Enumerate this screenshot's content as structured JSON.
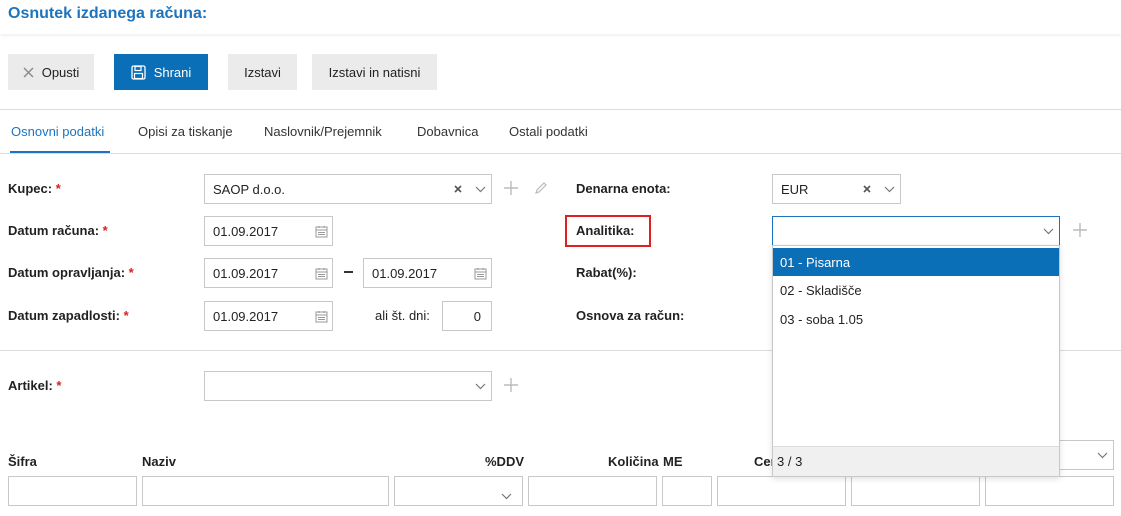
{
  "header": {
    "title": "Osnutek izdanega računa:"
  },
  "toolbar": {
    "cancel_label": "Opusti",
    "save_label": "Shrani",
    "issue_label": "Izstavi",
    "issue_print_label": "Izstavi in natisni"
  },
  "tabs": [
    {
      "label": "Osnovni podatki",
      "active": true
    },
    {
      "label": "Opisi za tiskanje"
    },
    {
      "label": "Naslovnik/Prejemnik"
    },
    {
      "label": "Dobavnica"
    },
    {
      "label": "Ostali podatki"
    }
  ],
  "form": {
    "kupec": {
      "label": "Kupec:",
      "value": "SAOP d.o.o."
    },
    "datum_racuna": {
      "label": "Datum računa:",
      "value": "01.09.2017"
    },
    "datum_opravljanja": {
      "label": "Datum opravljanja:",
      "from": "01.09.2017",
      "to": "01.09.2017"
    },
    "datum_zapadlosti": {
      "label": "Datum zapadlosti:",
      "value": "01.09.2017",
      "days_label": "ali št. dni:",
      "days_value": "0"
    },
    "denarna_enota": {
      "label": "Denarna enota:",
      "value": "EUR"
    },
    "analitika": {
      "label": "Analitika:",
      "value": ""
    },
    "rabat": {
      "label": "Rabat(%):"
    },
    "osnova": {
      "label": "Osnova za račun:"
    },
    "artikel": {
      "label": "Artikel:",
      "value": ""
    },
    "required_mark": "*"
  },
  "analitika_dropdown": {
    "options": [
      "01 - Pisarna",
      "02 - Skladišče",
      "03 - soba 1.05"
    ],
    "selected_index": 0,
    "footer": "3 / 3"
  },
  "table": {
    "headers": [
      "Šifra",
      "Naziv",
      "%DDV",
      "Količina",
      "ME",
      "Cen"
    ]
  },
  "colors": {
    "accent": "#1e73be",
    "primary_button": "#0a6fb7",
    "required": "#d62020",
    "highlight": "#e02020"
  }
}
